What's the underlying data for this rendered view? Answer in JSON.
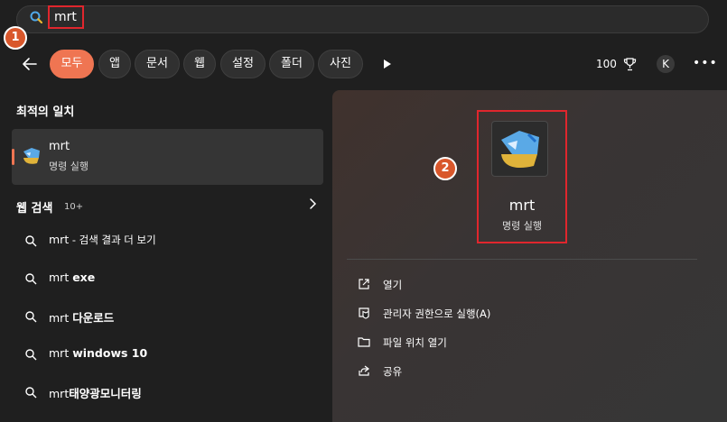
{
  "search": {
    "query": "mrt"
  },
  "badges": {
    "one": "1",
    "two": "2"
  },
  "filters": [
    "모두",
    "앱",
    "문서",
    "웹",
    "설정",
    "폴더",
    "사진"
  ],
  "header_right": {
    "points": "100",
    "avatar_initial": "K",
    "more": "•••"
  },
  "best_match": {
    "title": "최적의 일치",
    "name": "mrt",
    "subtitle": "명령 실행"
  },
  "web_search": {
    "title": "웹 검색",
    "count": "10+",
    "results": [
      {
        "prefix": "mrt",
        "suffix": " - 검색 결과 더 보기",
        "bold": false
      },
      {
        "prefix": "mrt ",
        "suffix": "exe",
        "bold": true
      },
      {
        "prefix": "mrt ",
        "suffix": "다운로드",
        "bold": true
      },
      {
        "prefix": "mrt ",
        "suffix": "windows 10",
        "bold": true
      },
      {
        "prefix": "mrt",
        "suffix": "태양광모니터링",
        "bold": true
      }
    ]
  },
  "preview": {
    "name": "mrt",
    "subtitle": "명령 실행",
    "actions": [
      "열기",
      "관리자 권한으로 실행(A)",
      "파일 위치 열기",
      "공유"
    ]
  },
  "colors": {
    "accent": "#ef7552",
    "highlight": "#e0262d",
    "badge": "#d9572b"
  }
}
